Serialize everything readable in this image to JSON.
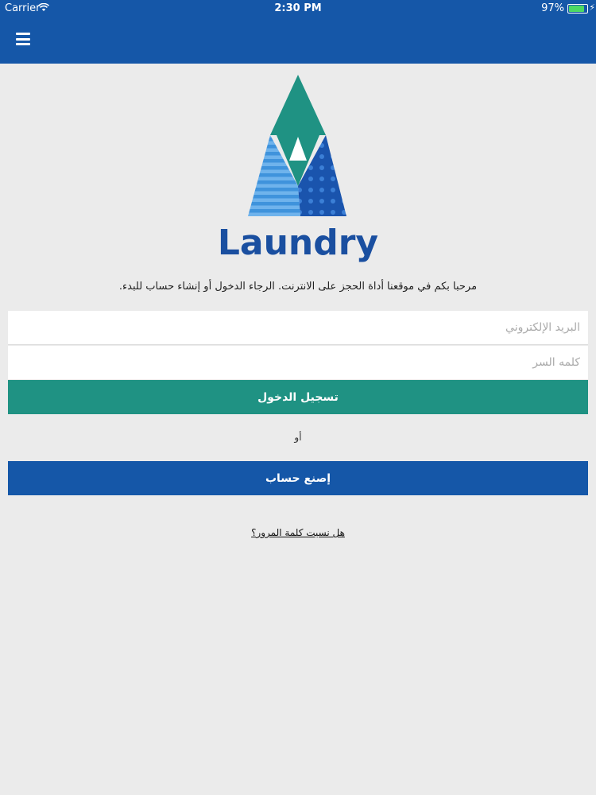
{
  "status_bar": {
    "carrier": "Carrier",
    "time": "2:30 PM",
    "battery_percent": "97%",
    "battery_level": 0.97,
    "wifi_icon": "wifi-icon"
  },
  "nav": {
    "menu_icon": "hamburger-menu-icon"
  },
  "logo": {
    "brand_text": "Laundry",
    "colors": {
      "teal": "#1f9283",
      "light_blue": "#4a9be0",
      "dark_blue": "#1a4fa0"
    }
  },
  "welcome_text": "مرحبا بكم في موقعنا أداة الحجز على الانترنت. الرجاء الدخول أو إنشاء حساب للبدء.",
  "form": {
    "email_placeholder": "البريد الإلكتروني",
    "password_placeholder": "كلمه السر",
    "login_label": "تسجيل الدخول",
    "or_label": "أو",
    "signup_label": "إصنع حساب",
    "forgot_label": "هل نسيت كلمة المرور؟"
  },
  "colors": {
    "header": "#1557a8",
    "login_button": "#1f9283",
    "signup_button": "#1557a8",
    "background": "#ebebeb"
  }
}
